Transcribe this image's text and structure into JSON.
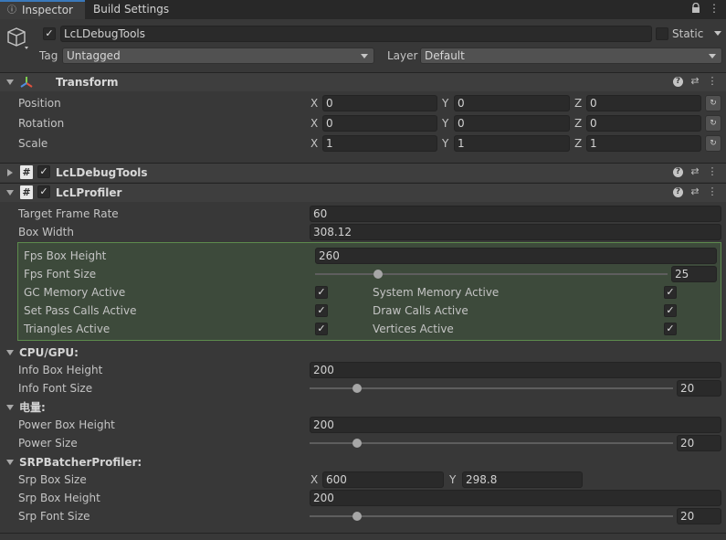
{
  "tabs": {
    "inspector": "Inspector",
    "build_settings": "Build Settings"
  },
  "object": {
    "name": "LcLDebugTools",
    "static_label": "Static",
    "tag_label": "Tag",
    "tag_value": "Untagged",
    "layer_label": "Layer",
    "layer_value": "Default"
  },
  "transform": {
    "title": "Transform",
    "rows": [
      {
        "label": "Position",
        "x": "0",
        "y": "0",
        "z": "0"
      },
      {
        "label": "Rotation",
        "x": "0",
        "y": "0",
        "z": "0"
      },
      {
        "label": "Scale",
        "x": "1",
        "y": "1",
        "z": "1"
      }
    ],
    "axis": {
      "x": "X",
      "y": "Y",
      "z": "Z"
    }
  },
  "components": {
    "debug_tools": "LcLDebugTools",
    "profiler": "LcLProfiler"
  },
  "profiler": {
    "target_frame_rate_label": "Target Frame Rate",
    "target_frame_rate": "60",
    "box_width_label": "Box Width",
    "box_width": "308.12",
    "fps_box_height_label": "Fps Box Height",
    "fps_box_height": "260",
    "fps_font_size_label": "Fps Font Size",
    "fps_font_size": "25",
    "fps_font_size_level": 0.17,
    "gc_memory_label": "GC Memory Active",
    "system_memory_label": "System Memory Active",
    "set_pass_label": "Set Pass Calls Active",
    "draw_calls_label": "Draw Calls Active",
    "triangles_label": "Triangles Active",
    "vertices_label": "Vertices Active",
    "cpu_gpu_section": "CPU/GPU:",
    "info_box_height_label": "Info Box Height",
    "info_box_height": "200",
    "info_font_size_label": "Info Font Size",
    "info_font_size": "20",
    "info_font_size_level": 0.12,
    "power_section": "电量:",
    "power_box_height_label": "Power Box Height",
    "power_box_height": "200",
    "power_size_label": "Power Size",
    "power_size": "20",
    "power_size_level": 0.12,
    "srp_section": "SRPBatcherProfiler:",
    "srp_box_size_label": "Srp Box Size",
    "srp_box_x": "600",
    "srp_box_y": "298.8",
    "srp_box_height_label": "Srp Box Height",
    "srp_box_height": "200",
    "srp_font_size_label": "Srp Font Size",
    "srp_font_size": "20",
    "srp_font_size_level": 0.12
  },
  "colors": {
    "background": "#383838",
    "highlight": "#3d4a3b",
    "highlight_border": "#5d8b4d",
    "tab_accent": "#3a79bb"
  }
}
